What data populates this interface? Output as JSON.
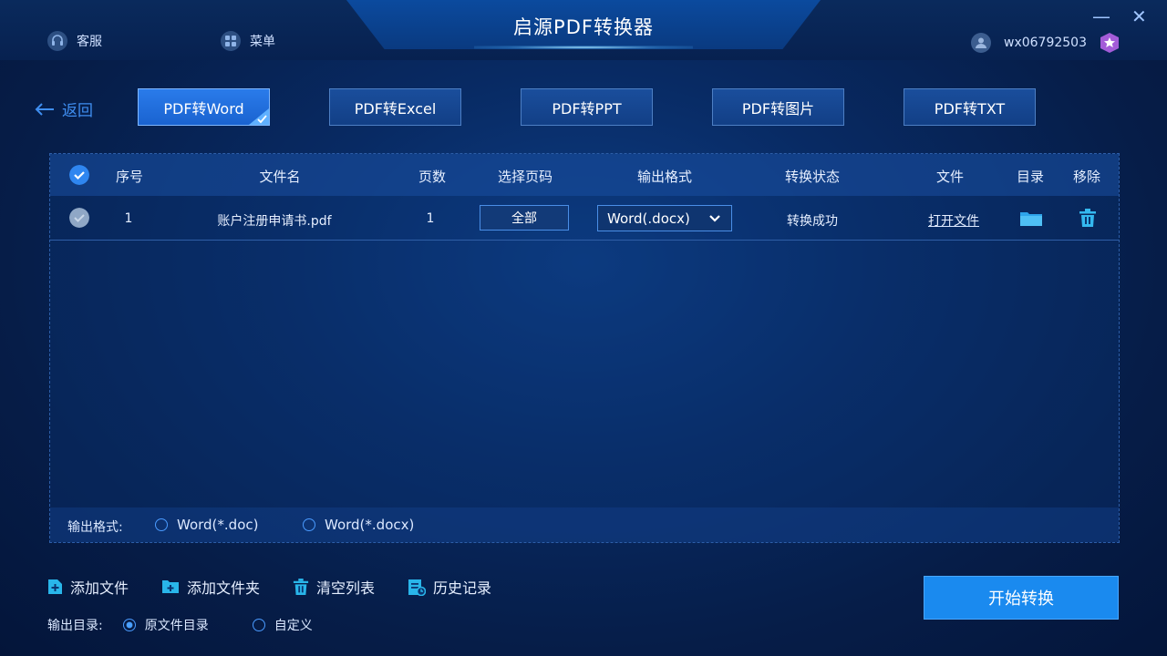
{
  "app": {
    "title": "启源PDF转换器"
  },
  "topbar": {
    "service_label": "客服",
    "menu_label": "菜单",
    "username": "wx06792503",
    "minimize_glyph": "—",
    "close_glyph": "✕"
  },
  "nav": {
    "back_label": "返回"
  },
  "tabs": [
    {
      "label": "PDF转Word",
      "active": true
    },
    {
      "label": "PDF转Excel",
      "active": false
    },
    {
      "label": "PDF转PPT",
      "active": false
    },
    {
      "label": "PDF转图片",
      "active": false
    },
    {
      "label": "PDF转TXT",
      "active": false
    }
  ],
  "table": {
    "headers": {
      "index": "序号",
      "filename": "文件名",
      "pages": "页数",
      "page_select": "选择页码",
      "output_format": "输出格式",
      "status": "转换状态",
      "file": "文件",
      "folder": "目录",
      "remove": "移除"
    },
    "rows": [
      {
        "index": "1",
        "filename": "账户注册申请书.pdf",
        "pages": "1",
        "page_select": "全部",
        "output_format": "Word(.docx)",
        "status": "转换成功",
        "file_action": "打开文件"
      }
    ]
  },
  "format_options": {
    "label": "输出格式:",
    "options": [
      "Word(*.doc)",
      "Word(*.docx)"
    ]
  },
  "actions": {
    "add_file": "添加文件",
    "add_folder": "添加文件夹",
    "clear_list": "清空列表",
    "history": "历史记录",
    "start": "开始转换"
  },
  "output_dir": {
    "label": "输出目录:",
    "options": [
      "原文件目录",
      "自定义"
    ],
    "selected": "原文件目录"
  },
  "colors": {
    "accent": "#1a8aef",
    "active_tab": "#2a7bea",
    "background": "#082a63"
  },
  "icons": [
    "headset-icon",
    "menu-grid-icon",
    "user-icon",
    "vip-badge-icon",
    "back-arrow-icon",
    "check-icon",
    "folder-icon",
    "trash-icon",
    "add-file-icon",
    "add-folder-icon",
    "history-icon",
    "chevron-down-icon"
  ]
}
